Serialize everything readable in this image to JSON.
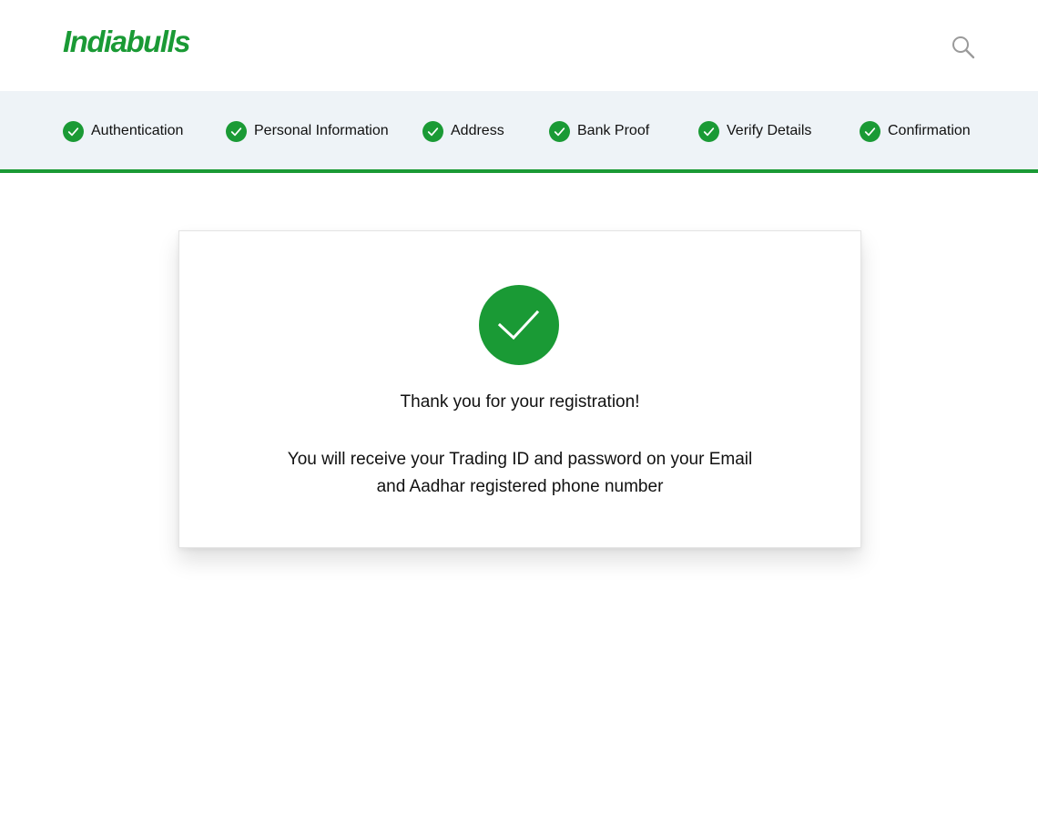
{
  "header": {
    "logo_text": "Indiabulls",
    "search_icon": "search-icon"
  },
  "colors": {
    "brand_green": "#1a9a35",
    "steps_background": "#eef3f7"
  },
  "steps": [
    {
      "label": "Authentication",
      "status": "completed",
      "icon": "check-circle-icon"
    },
    {
      "label": "Personal Information",
      "status": "completed",
      "icon": "check-circle-icon"
    },
    {
      "label": "Address",
      "status": "completed",
      "icon": "check-circle-icon"
    },
    {
      "label": "Bank Proof",
      "status": "completed",
      "icon": "check-circle-icon"
    },
    {
      "label": "Verify Details",
      "status": "completed",
      "icon": "check-circle-icon"
    },
    {
      "label": "Confirmation",
      "status": "completed",
      "icon": "check-circle-icon"
    }
  ],
  "confirmation": {
    "icon": "success-check-icon",
    "title": "Thank you for your registration!",
    "message_line1": "You will receive your Trading ID and password on your Email",
    "message_line2": "and Aadhar registered phone number"
  }
}
